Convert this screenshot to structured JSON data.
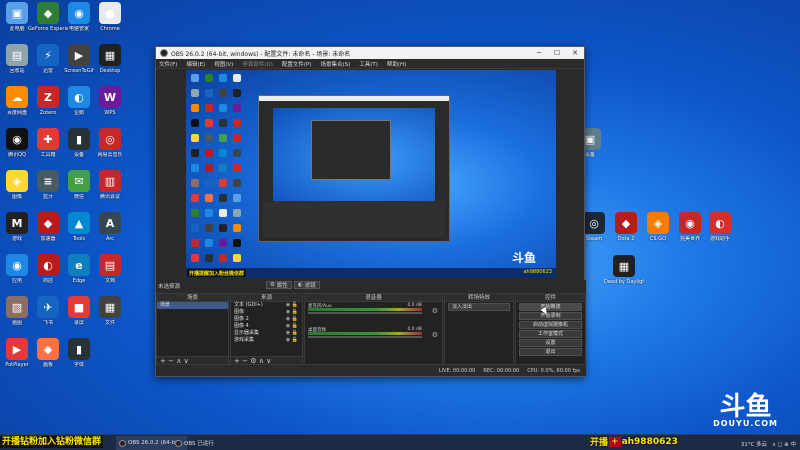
{
  "desktop_icons_left": [
    {
      "label": "此电脑",
      "color": "#5aa0e6",
      "glyph": "▣"
    },
    {
      "label": "GeForce Experience",
      "color": "#2e7d32",
      "glyph": "◆"
    },
    {
      "label": "电脑管家",
      "color": "#1e88e5",
      "glyph": "◉"
    },
    {
      "label": "Chrome",
      "color": "#e8eaed",
      "glyph": "●"
    },
    {
      "label": "回收站",
      "color": "#90a4ae",
      "glyph": "▤"
    },
    {
      "label": "迅雷",
      "color": "#1565c0",
      "glyph": "⚡"
    },
    {
      "label": "ScreenToGif",
      "color": "#424242",
      "glyph": "▶"
    },
    {
      "label": "Desktop",
      "color": "#212121",
      "glyph": "▦"
    },
    {
      "label": "百度网盘",
      "color": "#fb8c00",
      "glyph": "☁"
    },
    {
      "label": "Zotero",
      "color": "#c62828",
      "glyph": "Z"
    },
    {
      "label": "企鹅",
      "color": "#1e88e5",
      "glyph": "◐"
    },
    {
      "label": "WPS",
      "color": "#6a1b9a",
      "glyph": "W"
    },
    {
      "label": "腾讯QQ",
      "color": "#111111",
      "glyph": "◉"
    },
    {
      "label": "工具箱",
      "color": "#e53935",
      "glyph": "✚"
    },
    {
      "label": "设备",
      "color": "#263238",
      "glyph": "▮"
    },
    {
      "label": "网易云音乐",
      "color": "#c62828",
      "glyph": "◎"
    },
    {
      "label": "图像",
      "color": "#fdd835",
      "glyph": "◈"
    },
    {
      "label": "蓝牙",
      "color": "#455a64",
      "glyph": "≡"
    },
    {
      "label": "微信",
      "color": "#43a047",
      "glyph": "✉"
    },
    {
      "label": "腾讯会议",
      "color": "#c62828",
      "glyph": "▥"
    },
    {
      "label": "游戏",
      "color": "#212121",
      "glyph": "M"
    },
    {
      "label": "加速器",
      "color": "#b71c1c",
      "glyph": "◆"
    },
    {
      "label": "Tools",
      "color": "#0288d1",
      "glyph": "▲"
    },
    {
      "label": "Arc",
      "color": "#37474f",
      "glyph": "A"
    },
    {
      "label": "应用",
      "color": "#1e88e5",
      "glyph": "◉"
    },
    {
      "label": "商店",
      "color": "#b71c1c",
      "glyph": "◐"
    },
    {
      "label": "Edge",
      "color": "#0d7fbf",
      "glyph": "e"
    },
    {
      "label": "文档",
      "color": "#c62828",
      "glyph": "▤"
    },
    {
      "label": "画图",
      "color": "#8d6e63",
      "glyph": "▧"
    },
    {
      "label": "飞书",
      "color": "#1565c0",
      "glyph": "✈"
    },
    {
      "label": "录屏",
      "color": "#e53935",
      "glyph": "■"
    },
    {
      "label": "文件",
      "color": "#424242",
      "glyph": "▦"
    },
    {
      "label": "PotPlayer",
      "color": "#e53935",
      "glyph": "▶"
    },
    {
      "label": "画板",
      "color": "#ff7043",
      "glyph": "◆"
    },
    {
      "label": "字体",
      "color": "#263238",
      "glyph": "▮"
    }
  ],
  "desktop_icons_right": [
    {
      "label": "设备",
      "color": "#607d8b",
      "glyph": "▣"
    },
    {
      "label": "Steam",
      "color": "#1b2838",
      "glyph": "◎"
    },
    {
      "label": "Dota 2",
      "color": "#b71c1c",
      "glyph": "◆"
    },
    {
      "label": "CS:GO",
      "color": "#f57c00",
      "glyph": "◈"
    },
    {
      "label": "完美世界",
      "color": "#c62828",
      "glyph": "◉"
    },
    {
      "label": "游戏助手",
      "color": "#d32f2f",
      "glyph": "◐"
    },
    {
      "label": "Dead by Daylight",
      "color": "#212121",
      "glyph": "▦"
    }
  ],
  "obs": {
    "title": "OBS 26.0.2 (64-bit, windows) - 配置文件: 未命名 - 场景: 未命名",
    "menu": [
      "文件(F)",
      "编辑(E)",
      "视图(V)",
      "停靠部件(D)",
      "配置文件(P)",
      "场景集合(S)",
      "工具(T)",
      "帮助(H)"
    ],
    "scene_label": "未选择源",
    "props_button": "属性",
    "filters_button": "滤镜",
    "docks": {
      "scenes_title": "场景",
      "sources_title": "来源",
      "mixer_title": "混音器",
      "transitions_title": "转场特效",
      "controls_title": "控件",
      "scenes": [
        "场景"
      ],
      "sources": [
        "文本 (GDI+)",
        "图像",
        "图像 2",
        "图像 4",
        "显示器采集",
        "游戏采集"
      ],
      "mixer": [
        {
          "name": "麦克风/Aux",
          "level": "0.0 dB"
        },
        {
          "name": "桌面音频",
          "level": "0.0 dB"
        }
      ],
      "transition_value": "淡入淡出",
      "controls": [
        "开始推流",
        "开始录制",
        "启动虚拟摄像机",
        "工作室模式",
        "设置",
        "退出"
      ]
    },
    "status": {
      "live": "LIVE: 00:00:00",
      "rec": "REC: 00:00:00",
      "cpu": "CPU: 0.0%, 60.00 fps"
    },
    "preview_banner": "开播提醒加入粉丝微信群",
    "preview_douyu": "斗鱼"
  },
  "taskbar": {
    "banner": "开播钻粉加入钻粉微信群",
    "items": [
      "OBS 26.0.2 (64-bit...",
      "OBS 已运行"
    ],
    "promo_left": "开播",
    "promo_mid": "+",
    "promo_right": "ah9880623",
    "weather": "31°C 多云",
    "tray_icons": "∧ ◻ ⊕ 中"
  },
  "watermark": {
    "big": "斗鱼",
    "small": "DOUYU.COM"
  }
}
